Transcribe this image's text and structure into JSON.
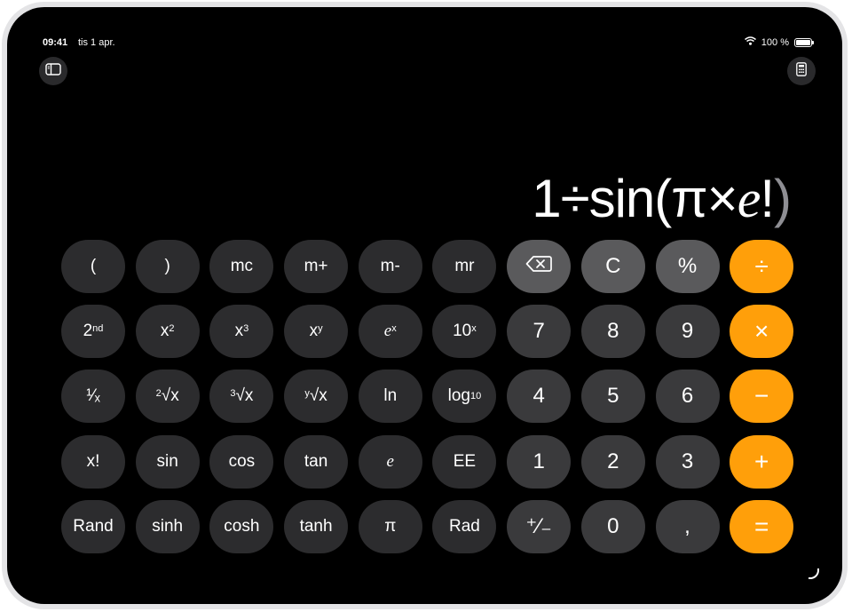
{
  "status_bar": {
    "time": "09:41",
    "date": "tis 1 apr.",
    "battery": "100 %"
  },
  "toolbar": {
    "sidebar_icon": "sidebar-icon",
    "calculator_icon": "calculator-icon"
  },
  "display": {
    "prefix": "1÷sin(π×",
    "e": "e",
    "suffix": "!",
    "cursor": ")"
  },
  "keys": {
    "open_paren": "(",
    "close_paren": ")",
    "mc": "mc",
    "m_plus": "m+",
    "m_minus": "m-",
    "mr": "mr",
    "clear": "C",
    "percent": "%",
    "divide": "÷",
    "second_base": "2",
    "second_sup": "nd",
    "x_sq_base": "x",
    "x_sq_sup": "2",
    "x_cube_base": "x",
    "x_cube_sup": "3",
    "x_y_base": "x",
    "x_y_sup": "y",
    "e_x_base": "e",
    "e_x_sup": "x",
    "ten_x_base": "10",
    "ten_x_sup": "x",
    "seven": "7",
    "eight": "8",
    "nine": "9",
    "multiply": "×",
    "reciprocal": "¹⁄ₓ",
    "sqrt2_idx": "2",
    "sqrt2_body": "√x",
    "sqrt3_idx": "3",
    "sqrt3_body": "√x",
    "sqrty_idx": "y",
    "sqrty_body": "√x",
    "ln": "ln",
    "log_base": "log",
    "log_sub": "10",
    "four": "4",
    "five": "5",
    "six": "6",
    "minus": "−",
    "factorial": "x!",
    "sin": "sin",
    "cos": "cos",
    "tan": "tan",
    "e": "e",
    "ee": "EE",
    "one": "1",
    "two": "2",
    "three": "3",
    "plus": "+",
    "rand": "Rand",
    "sinh": "sinh",
    "cosh": "cosh",
    "tanh": "tanh",
    "pi": "π",
    "rad": "Rad",
    "plus_minus": "⁺⁄₋",
    "zero": "0",
    "decimal": ",",
    "equals": "="
  },
  "colors": {
    "operator": "#ff9f0a",
    "digit": "#3a3a3c",
    "function": "#2c2c2e",
    "top_gray": "#5a5a5c"
  }
}
